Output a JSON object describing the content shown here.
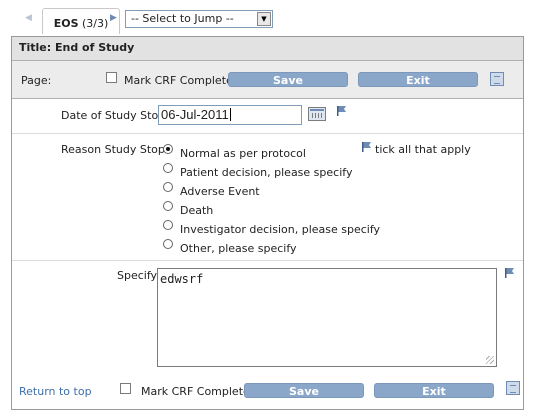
{
  "nav": {
    "tab_code": "EOS",
    "tab_count": "(3/3)",
    "jump_select_value": "-- Select to Jump --"
  },
  "form": {
    "title": "Title: End of Study",
    "page_label": "Page:",
    "mark_crf_label": "Mark CRF Complete",
    "save_label": "Save",
    "exit_label": "Exit"
  },
  "fields": {
    "date_label": "Date of Study Stop",
    "date_value": "06-Jul-2011",
    "reason_label": "Reason Study Stop",
    "tick_hint": "tick all that apply",
    "reason_options": [
      {
        "label": "Normal as per protocol",
        "selected": true
      },
      {
        "label": "Patient decision, please specify",
        "selected": false
      },
      {
        "label": "Adverse Event",
        "selected": false
      },
      {
        "label": "Death",
        "selected": false
      },
      {
        "label": "Investigator decision, please specify",
        "selected": false
      },
      {
        "label": "Other, please specify",
        "selected": false
      }
    ],
    "specify_label": "Specify",
    "specify_value": "edwsrf"
  },
  "footer": {
    "return_link": "Return to top",
    "mark_crf_label": "Mark CRF Complete",
    "save_label": "Save",
    "exit_label": "Exit"
  },
  "colors": {
    "button": "#8aa6c9",
    "title_bar": "#e2e2e2",
    "link": "#3f6fa8"
  }
}
